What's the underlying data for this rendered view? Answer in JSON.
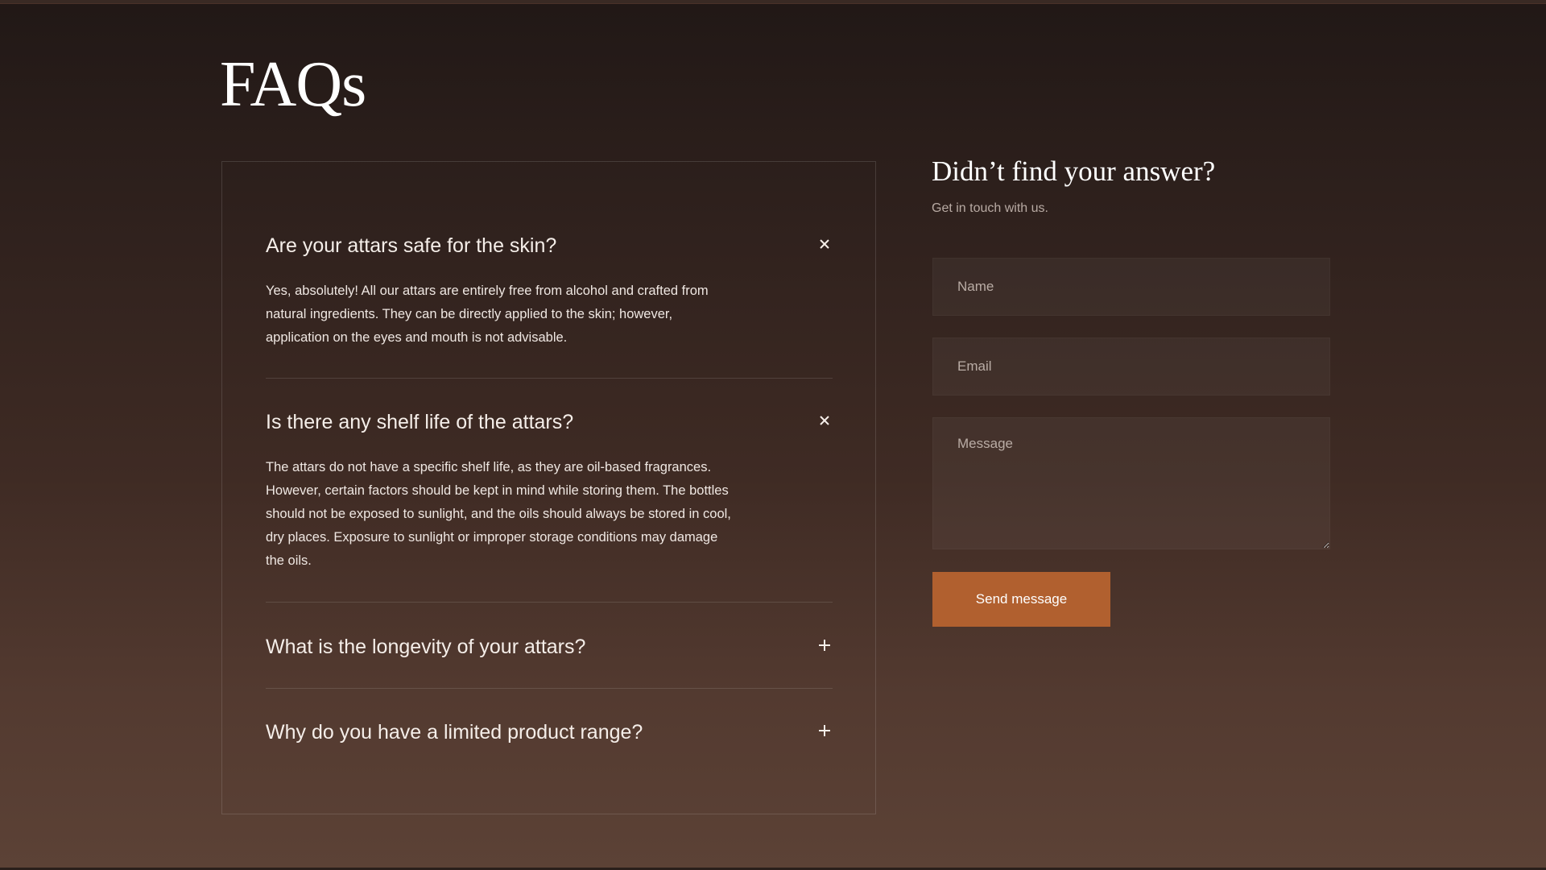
{
  "page": {
    "title": "FAQs"
  },
  "faq": {
    "items": [
      {
        "question": "Are your attars safe for the skin?",
        "expanded": true,
        "toggle_icon": "close-icon",
        "answer": "Yes, absolutely! All our attars are entirely free from alcohol and crafted from natural ingredients. They can be directly applied to the skin; however, application on the eyes and mouth is not advisable."
      },
      {
        "question": "Is there any shelf life of the attars?",
        "expanded": true,
        "toggle_icon": "close-icon",
        "answer": "The attars do not have a specific shelf life, as they are oil-based fragrances. However, certain factors should be kept in mind while storing them. The bottles should not be exposed to sunlight, and the oils should always be stored in cool, dry places. Exposure to sunlight or improper storage conditions may damage the oils."
      },
      {
        "question": "What is the longevity of your attars?",
        "expanded": false,
        "toggle_icon": "plus-icon"
      },
      {
        "question": "Why do you have a limited product range?",
        "expanded": false,
        "toggle_icon": "plus-icon"
      }
    ]
  },
  "contact": {
    "title": "Didn’t find your answer?",
    "subtitle": "Get in touch with us.",
    "name_placeholder": "Name",
    "email_placeholder": "Email",
    "message_placeholder": "Message",
    "submit_label": "Send message"
  },
  "colors": {
    "accent": "#b1602f",
    "background_top": "#211816",
    "background_bottom": "#5c4236"
  }
}
